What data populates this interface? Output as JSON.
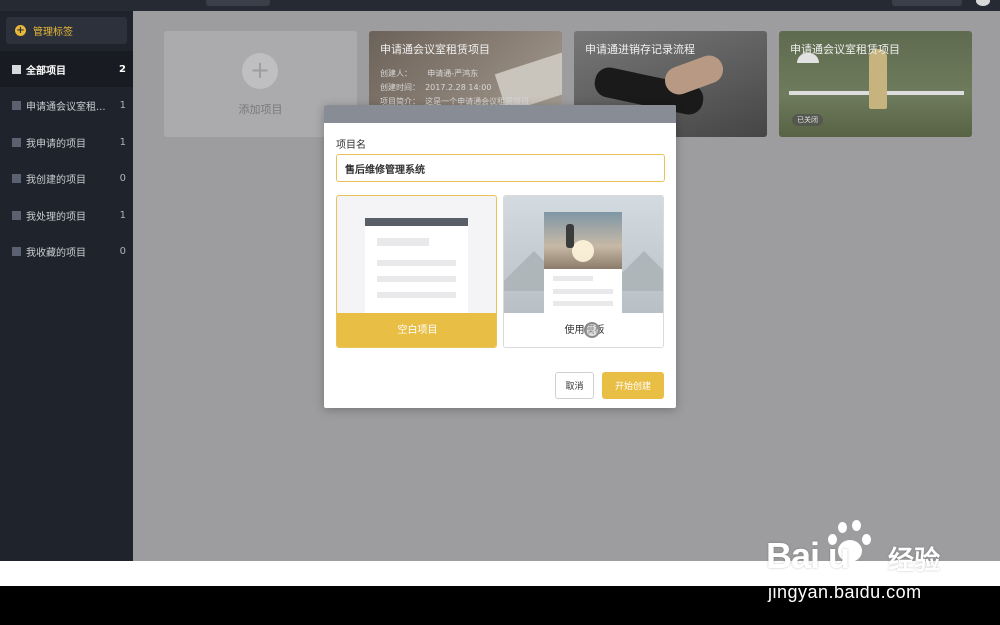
{
  "sidebar": {
    "manage_label": "管理标签",
    "items": [
      {
        "label": "全部项目",
        "count": "2"
      },
      {
        "label": "申请通会议室租...",
        "count": "1"
      },
      {
        "label": "我申请的项目",
        "count": "1"
      },
      {
        "label": "我创建的项目",
        "count": "0"
      },
      {
        "label": "我处理的项目",
        "count": "1"
      },
      {
        "label": "我收藏的项目",
        "count": "0"
      }
    ]
  },
  "main": {
    "add_label": "添加项目",
    "cards": [
      {
        "title": "申请通会议室租赁项目",
        "creator_label": "创建人：",
        "creator": "申请通-严鸿东",
        "time_label": "创建时间：",
        "time": "2017.2.28 14:00",
        "desc_label": "项目简介：",
        "desc": "这是一个申请通会议租赁项目"
      },
      {
        "title": "申请通进销存记录流程"
      },
      {
        "title": "申请通会议室租赁项目",
        "badge": "已关闭"
      }
    ]
  },
  "modal": {
    "field_label": "项目名",
    "name_value": "售后维修管理系统",
    "option_blank": "空白项目",
    "option_template": "使用模板",
    "cancel": "取消",
    "start": "开始创建"
  },
  "watermark": {
    "logo": "Bai  u",
    "cn": "经验",
    "url": "jingyan.baidu.com"
  },
  "colors": {
    "accent": "#e8be44",
    "sidebar_bg": "#1f232b",
    "overlay_bg": "#9d9d9f"
  }
}
